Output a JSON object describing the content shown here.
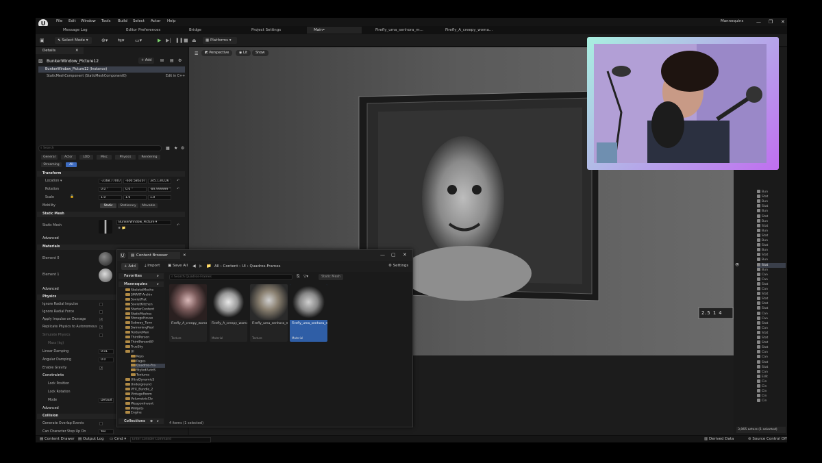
{
  "menu": {
    "items": [
      "File",
      "Edit",
      "Window",
      "Tools",
      "Build",
      "Select",
      "Actor",
      "Help"
    ],
    "project": "Mannequins"
  },
  "tabs": [
    {
      "label": "Message Log"
    },
    {
      "label": "Editor Preferences"
    },
    {
      "label": "Bridge"
    },
    {
      "label": "Project Settings"
    },
    {
      "label": "Main•"
    },
    {
      "label": "Firefly_uma_senhora_m..."
    },
    {
      "label": "Firefly_A_creepy_woma..."
    }
  ],
  "toolbar": {
    "select_mode": "Select Mode",
    "platforms": "Platforms"
  },
  "details": {
    "tab_label": "Details",
    "actor_name": "BunkerWindow_Picture12",
    "add_label": "+ Add",
    "instance_row": "BunkerWindow_Picture12 (Instance)",
    "component_row": "StaticMeshComponent (StaticMeshComponent0)",
    "edit_cpp": "Edit in C++",
    "search_placeholder": "Search",
    "categories": [
      "General",
      "Actor",
      "LOD",
      "Misc",
      "Physics",
      "Rendering",
      "Streaming",
      "All"
    ],
    "transform": {
      "section": "Transform",
      "location_label": "Location",
      "location": [
        "-3168.770073",
        "-600.586207",
        "345.130226"
      ],
      "rotation_label": "Rotation",
      "rotation": [
        "0.0 °",
        "0.0 °",
        "-89.999999 °"
      ],
      "scale_label": "Scale",
      "scale": [
        "1.0",
        "1.0",
        "1.0"
      ],
      "mobility_label": "Mobility",
      "mobility": [
        "Static",
        "Stationary",
        "Movable"
      ]
    },
    "static_mesh": {
      "section": "Static Mesh",
      "label": "Static Mesh",
      "value": "BunkerWindow_Picture"
    },
    "advanced": "Advanced",
    "materials": {
      "section": "Materials",
      "element0_label": "Element 0",
      "element0_value": "PictureFrameWood_a_Mat",
      "element1_label": "Element 1"
    },
    "physics": {
      "section": "Physics",
      "rows": [
        "Ignore Radial Impulse",
        "Ignore Radial Force",
        "Apply Impulse on Damage",
        "Replicate Physics to Autonomous",
        "Simulate Physics",
        "Mass (kg)",
        "Linear Damping",
        "Angular Damping",
        "Enable Gravity"
      ],
      "linear_damping": "0.01",
      "angular_damping": "0.0",
      "constraints": "Constraints",
      "lock_position": "Lock Position",
      "lock_rotation": "Lock Rotation",
      "mode": "Mode",
      "mode_value": "Default"
    },
    "collision": {
      "section": "Collision",
      "rows": [
        "Generate Overlap Events",
        "Can Character Step Up On",
        "Collision Presets",
        "Simulation Generates Hit Events"
      ],
      "step_up_value": "Yes",
      "presets_value": "Default"
    }
  },
  "viewport": {
    "perspective": "Perspective",
    "lit": "Lit",
    "show": "Show",
    "frame_text": "2.5 1 4"
  },
  "content_browser": {
    "title": "Content Browser",
    "add": "+ Add",
    "import": "Import",
    "save_all": "Save All",
    "breadcrumb": [
      "All",
      "Content",
      "UI",
      "Quadros-Frames"
    ],
    "settings": "Settings",
    "favorites": "Favorites",
    "project": "Mannequins",
    "search_placeholder": "Search Quadros-Frames",
    "static_mesh_filter": "Static Mesh",
    "folders": [
      "SkeletalMeshe",
      "SMART-Archiv",
      "SovietFlat",
      "SovietKitchen",
      "StarterContent",
      "StaticMeshes",
      "StorageHouse",
      "Subway_Tunn",
      "SwimmingPool",
      "TextureMax",
      "ThirdPerson",
      "ThirdPersonBP",
      "TrueSky",
      "UI",
      "Keys",
      "Pages",
      "Quadros-Fra",
      "StyledAutoS",
      "Textures",
      "UltraDynamicS",
      "Underground",
      "VFX_Bundle_2",
      "VintageRoom",
      "VolumetricClo",
      "WeaponInvent",
      "Widgets",
      "Engine"
    ],
    "collections": "Collections",
    "assets": [
      {
        "name": "Firefly_A_creepy_woman_69116",
        "type": "Texture"
      },
      {
        "name": "Firefly_A_creepy_woman_69116_Mat",
        "type": "Material"
      },
      {
        "name": "Firefly_uma_senhora_muito_idosa_e_doente_sorrindo_em_um_...",
        "type": "Texture"
      },
      {
        "name": "Firefly_uma_senhora_muito_idosa_e_doente_sorrindo_em_um_...",
        "type": "Material"
      }
    ],
    "status": "4 items (1 selected)"
  },
  "outliner": {
    "rows": [
      "Bun",
      "Stat",
      "Bun",
      "Stat",
      "Bun",
      "Stat",
      "Bun",
      "Stat",
      "Bun",
      "Stat",
      "Bun",
      "Stat",
      "Bun",
      "Stat",
      "Bun",
      "Stat",
      "Bun",
      "Can",
      "Can",
      "Stat",
      "Can",
      "Stat",
      "Stat",
      "Stat",
      "Stat",
      "Can",
      "Can",
      "Stat",
      "Can",
      "Stat",
      "Stat",
      "Stat",
      "Stat",
      "Can",
      "Can",
      "Stat",
      "Stat",
      "Can",
      "Edit",
      "Cin",
      "Cin",
      "Cin",
      "Cin",
      "Cin"
    ],
    "footer": "3,065 actors (1 selected)"
  },
  "statusbar": {
    "content_drawer": "Content Drawer",
    "output_log": "Output Log",
    "cmd": "Cmd",
    "console_placeholder": "Enter Console Command",
    "derived_data": "Derived Data",
    "source_control": "Source Control Off"
  },
  "colors": {
    "accent": "#3e6cc0",
    "play": "#7bd36e",
    "folder": "#b08a45"
  }
}
